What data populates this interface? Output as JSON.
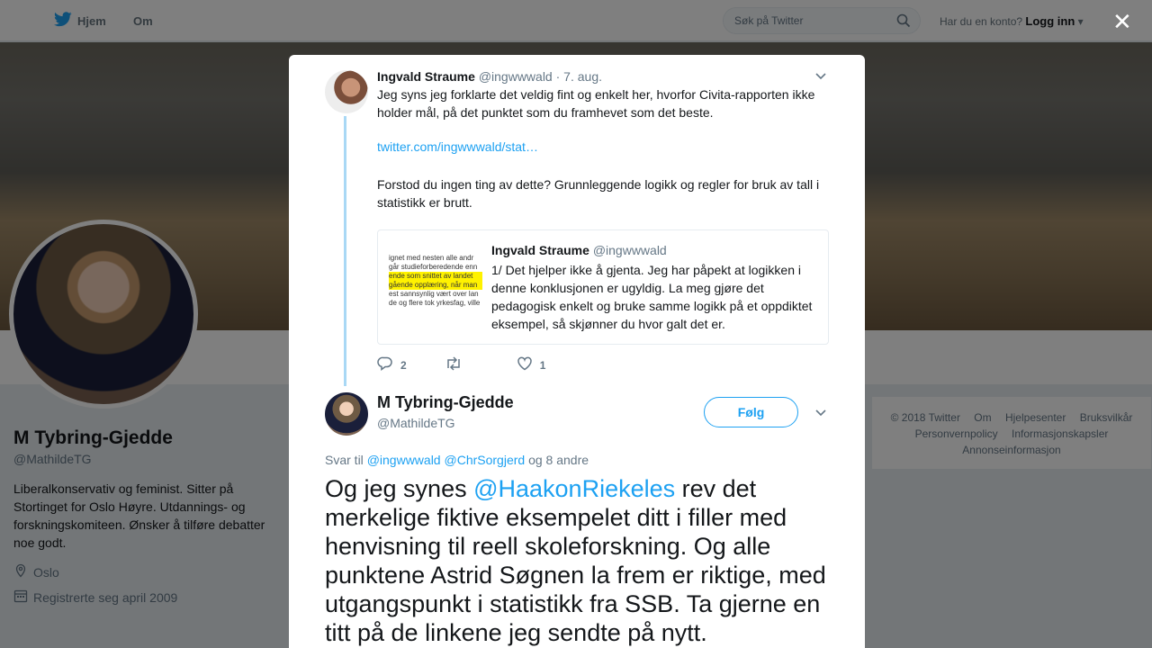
{
  "nav": {
    "home_label": "Hjem",
    "om_label": "Om",
    "search_placeholder": "Søk på Twitter",
    "account_question": "Har du en konto?",
    "login_label": "Logg inn"
  },
  "profile": {
    "name": "M Tybring-Gjedde",
    "handle": "@MathildeTG",
    "bio": "Liberalkonservativ og feminist. Sitter på Stortinget for Oslo Høyre. Utdannings- og forskningskomiteen. Ønsker å tilføre debatter noe godt.",
    "location": "Oslo",
    "joined": "Registrerte seg april 2009"
  },
  "footer": {
    "items": [
      "© 2018 Twitter",
      "Om",
      "Hjelpesenter",
      "Bruksvilkår",
      "Personvernpolicy",
      "Informasjonskapsler",
      "Annonseinformasjon"
    ]
  },
  "parent_tweet": {
    "name": "Ingvald Straume",
    "handle": "@ingwwwald",
    "date": "· 7. aug.",
    "text1": "Jeg syns jeg forklarte det veldig fint og enkelt her, hvorfor Civita-rapporten ikke holder mål, på det punktet som du framhevet som det beste.",
    "link": "twitter.com/ingwwwald/stat…",
    "text2": "Forstod du ingen ting av dette? Grunnleggende logikk og regler for bruk av tall i statistikk er brutt.",
    "replies": "2",
    "likes": "1"
  },
  "quoted_tweet": {
    "name": "Ingvald Straume",
    "handle": "@ingwwwald",
    "text": "1/  Det hjelper ikke å gjenta. Jeg har påpekt at logikken i denne konklusjonen er ugyldig. La meg gjøre det pedagogisk enkelt og bruke samme logikk på et oppdiktet eksempel, så skjønner du hvor galt det er.",
    "image_lines": [
      "ignet med nesten alle andr",
      "går studieforberedende enn",
      "ende som snittet av landet",
      "gående opplæring, når man",
      "est sannsynlig vært over lan",
      "de og flere tok yrkesfag, ville"
    ]
  },
  "main_tweet": {
    "name": "M Tybring-Gjedde",
    "handle": "@MathildeTG",
    "follow_label": "Følg",
    "reply_prefix": "Svar til",
    "reply_user1": "@ingwwwald",
    "reply_user2": "@ChrSorgjerd",
    "reply_suffix": "og 8 andre",
    "text_pre": "Og jeg synes ",
    "mention": "@HaakonRiekeles",
    "text_post": " rev det merkelige fiktive eksempelet ditt i filler med henvisning til reell skoleforskning. Og alle punktene Astrid Søgnen la frem er riktige, med utgangspunkt i statistikk fra SSB. Ta gjerne en titt på de linkene jeg sendte på nytt."
  },
  "colors": {
    "brand": "#1da1f2",
    "muted": "#657786",
    "thread": "#a9d8f5"
  }
}
